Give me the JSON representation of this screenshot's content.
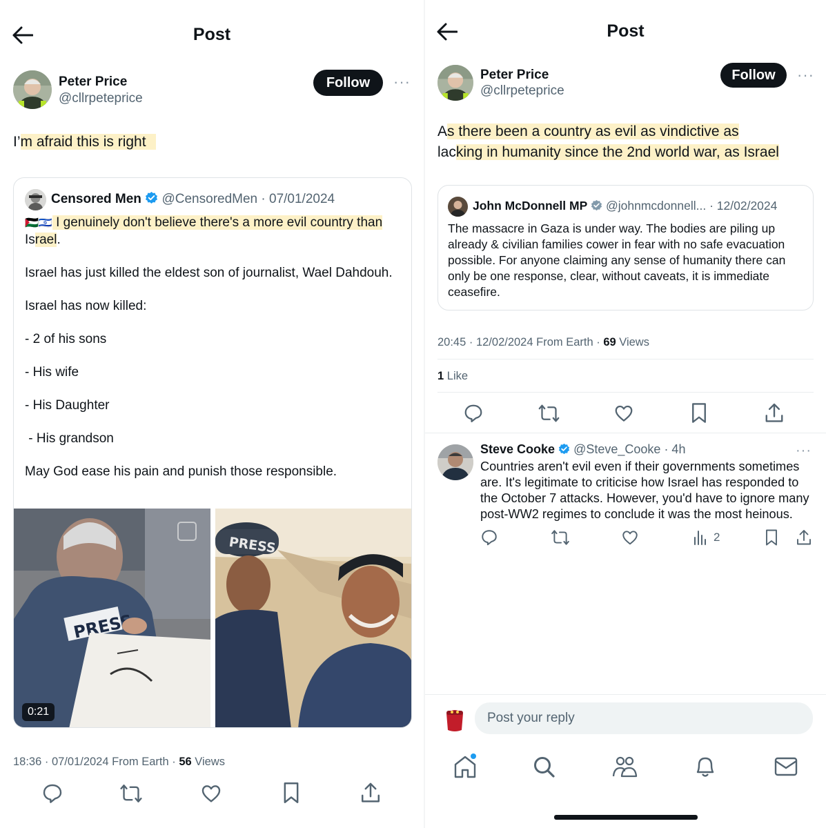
{
  "left": {
    "header_title": "Post",
    "author": {
      "name": "Peter Price",
      "handle": "@cllrpeteprice"
    },
    "follow_label": "Follow",
    "more_glyph": "···",
    "post_text_pre": "I’",
    "post_text_hl": "m afraid this is right",
    "quote": {
      "name": "Censored Men",
      "handle": "@CensoredMen",
      "date": "· 07/01/2024",
      "flags": "🇵🇸🇮🇱",
      "line1_hl": " I genuinely don't believe there's a more evil country than",
      "line2_pre": "Is",
      "line2_hl": "rael",
      "line2_post": ".",
      "para2": "Israel has just killed the eldest son of journalist, Wael Dahdouh.",
      "para3": "Israel has now killed:",
      "list": [
        "- 2 of his sons",
        "- His wife",
        "- His Daughter",
        " - His grandson"
      ],
      "para4": "May God ease his pain and punish those responsible.",
      "video_duration": "0:21",
      "press_label_1": "PRESS",
      "press_label_2": "PRESS"
    },
    "meta_time": "18:36 · 07/01/2024 From Earth · ",
    "meta_views_count": "56",
    "meta_views_label": " Views"
  },
  "right": {
    "header_title": "Post",
    "author": {
      "name": "Peter Price",
      "handle": "@cllrpeteprice"
    },
    "follow_label": "Follow",
    "more_glyph": "···",
    "post_line1_pre": "A",
    "post_line1_hl": "s there been a country as evil as vindictive as",
    "post_line2_pre": "lac",
    "post_line2_hl": "king in humanity since the 2nd world war, as Israel",
    "quote": {
      "name": "John McDonnell MP",
      "handle": "@johnmcdonnell...",
      "date": "· 12/02/2024",
      "text": "The massacre in Gaza is under way. The bodies are piling up already & civilian families cower in fear with no safe evacuation possible. For anyone claiming any sense of humanity there can only be one response, clear, without caveats, it is immediate ceasefire."
    },
    "meta_time": "20:45 · 12/02/2024 From Earth · ",
    "meta_views_count": "69",
    "meta_views_label": " Views",
    "likes_count": "1",
    "likes_label": " Like",
    "reply": {
      "name": "Steve Cooke",
      "handle": "@Steve_Cooke",
      "time": "· 4h",
      "text": "Countries aren't evil even if their governments sometimes are. It's legitimate to criticise how Israel has responded to the October 7 attacks. However, you'd have to ignore many post-WW2 regimes to conclude it was the most heinous.",
      "views_count": "2"
    },
    "reply_placeholder": "Post your reply"
  },
  "colors": {
    "text": "#0f1419",
    "secondary": "#536471",
    "verified": "#1d9bf0",
    "highlight": "#fdf1c7",
    "follow_bg": "#0f1419",
    "notification_dot": "#1d9bf0"
  },
  "icons": [
    "back-arrow-icon",
    "more-icon",
    "verified-icon",
    "reply-icon",
    "retweet-icon",
    "like-icon",
    "bookmark-icon",
    "share-icon",
    "views-icon",
    "home-icon",
    "search-icon",
    "communities-icon",
    "notifications-icon",
    "messages-icon",
    "video-icon"
  ]
}
